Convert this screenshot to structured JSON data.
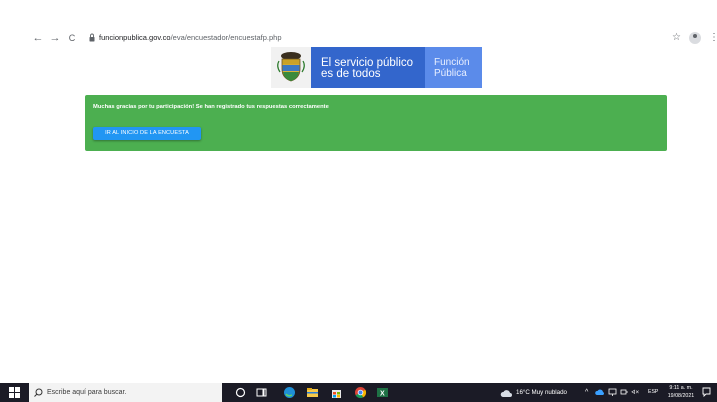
{
  "browser": {
    "url_domain": "funcionpublica.gov.co",
    "url_path": "/eva/encuestador/encuestafp.php",
    "back_glyph": "←",
    "forward_glyph": "→",
    "reload_glyph": "C",
    "star_glyph": "☆",
    "menu_glyph": "⋮"
  },
  "banner": {
    "line1": "El servicio público",
    "line2": "es de todos",
    "line3": "Función",
    "line4": "Pública",
    "colors": {
      "blue": "#3366cc",
      "light_blue": "#5b8bea"
    }
  },
  "alert": {
    "message": "Muchas gracias por tu participación! Se han registrado tus respuestas correctamente",
    "button_label": "IR AL INICIO DE LA ENCUESTA",
    "colors": {
      "background": "#4caf50",
      "button": "#2196f3"
    }
  },
  "taskbar": {
    "search_placeholder": "Escribe aquí para buscar.",
    "weather": "16°C  Muy nublado",
    "chevron": "^",
    "speaker": "ᗏ×",
    "lang": "ESP",
    "time": "9:11 a. m.",
    "date": "19/08/2021",
    "apps": [
      "cortana-icon",
      "task-view-icon",
      "edge-icon",
      "file-explorer-icon",
      "store-icon",
      "chrome-icon",
      "excel-icon"
    ]
  }
}
